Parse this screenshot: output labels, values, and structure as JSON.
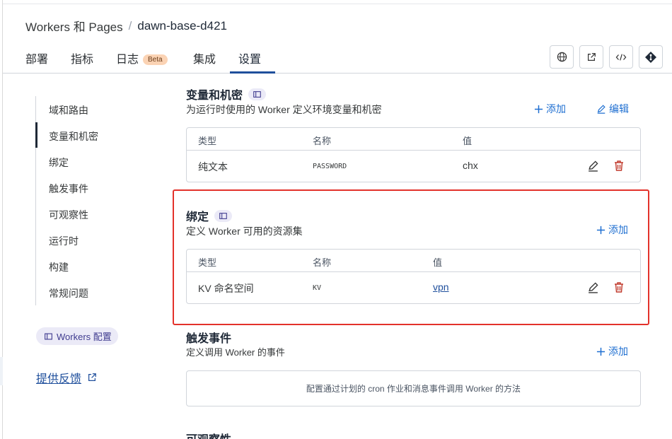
{
  "breadcrumb": {
    "parent": "Workers 和 Pages",
    "separator": "/",
    "current": "dawn-base-d421"
  },
  "tabs": [
    {
      "label": "部署"
    },
    {
      "label": "指标"
    },
    {
      "label": "日志",
      "badge": "Beta"
    },
    {
      "label": "集成"
    },
    {
      "label": "设置",
      "active": true
    }
  ],
  "toolbar": {
    "icons": [
      "globe-icon",
      "external-link-icon",
      "code-icon",
      "git-icon"
    ]
  },
  "sidebar": {
    "items": [
      {
        "label": "域和路由"
      },
      {
        "label": "变量和机密",
        "active": true
      },
      {
        "label": "绑定"
      },
      {
        "label": "触发事件"
      },
      {
        "label": "可观察性"
      },
      {
        "label": "运行时"
      },
      {
        "label": "构建"
      },
      {
        "label": "常规问题"
      }
    ],
    "config_pill": "Workers 配置",
    "feedback": "提供反馈"
  },
  "variables": {
    "title": "变量和机密",
    "desc": "为运行时使用的 Worker 定义环境变量和机密",
    "add_label": "添加",
    "edit_label": "编辑",
    "headers": [
      "类型",
      "名称",
      "值"
    ],
    "rows": [
      {
        "type": "纯文本",
        "name": "PASSWORD",
        "value": "chx"
      }
    ]
  },
  "bindings": {
    "title": "绑定",
    "desc": "定义 Worker 可用的资源集",
    "add_label": "添加",
    "headers": [
      "类型",
      "名称",
      "值"
    ],
    "rows": [
      {
        "type": "KV 命名空间",
        "name": "KV",
        "value": "vpn"
      }
    ]
  },
  "triggers": {
    "title": "触发事件",
    "desc": "定义调用 Worker 的事件",
    "add_label": "添加",
    "empty_text": "配置通过计划的 cron 作业和消息事件调用 Worker 的方法"
  },
  "observability": {
    "title": "可观察性"
  },
  "colors": {
    "accent": "#1f6fd1",
    "danger": "#c0392b",
    "highlight": "#e3322b",
    "brand_text": "#1f4f9c"
  }
}
